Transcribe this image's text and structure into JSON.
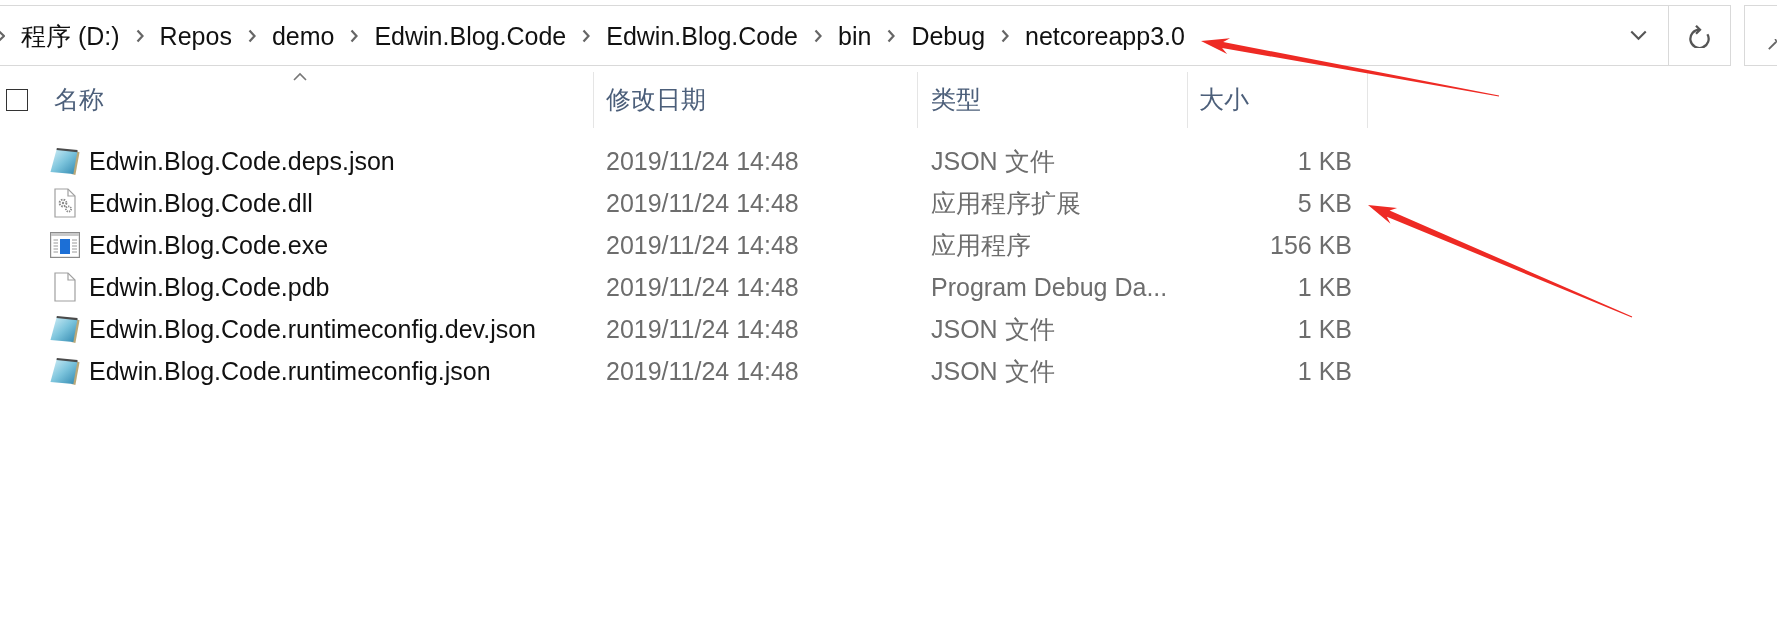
{
  "address_bar": {
    "breadcrumb": [
      "程序 (D:)",
      "Repos",
      "demo",
      "Edwin.Blog.Code",
      "Edwin.Blog.Code",
      "bin",
      "Debug",
      "netcoreapp3.0"
    ]
  },
  "file_list": {
    "select_all": {
      "checked": false
    },
    "columns": [
      {
        "label": "名称",
        "sorted": true
      },
      {
        "label": "修改日期",
        "sorted": false
      },
      {
        "label": "类型",
        "sorted": false
      },
      {
        "label": "大小",
        "sorted": false
      }
    ],
    "files": [
      {
        "kind": "json",
        "name": "Edwin.Blog.Code.deps.json",
        "date_modified": "2019/11/24 14:48",
        "type": "JSON 文件",
        "size": "1 KB"
      },
      {
        "kind": "dll",
        "name": "Edwin.Blog.Code.dll",
        "date_modified": "2019/11/24 14:48",
        "type": "应用程序扩展",
        "size": "5 KB"
      },
      {
        "kind": "exe",
        "name": "Edwin.Blog.Code.exe",
        "date_modified": "2019/11/24 14:48",
        "type": "应用程序",
        "size": "156 KB"
      },
      {
        "kind": "file",
        "name": "Edwin.Blog.Code.pdb",
        "date_modified": "2019/11/24 14:48",
        "type": "Program Debug Da...",
        "size": "1 KB"
      },
      {
        "kind": "json",
        "name": "Edwin.Blog.Code.runtimeconfig.dev.json",
        "date_modified": "2019/11/24 14:48",
        "type": "JSON 文件",
        "size": "1 KB"
      },
      {
        "kind": "json",
        "name": "Edwin.Blog.Code.runtimeconfig.json",
        "date_modified": "2019/11/24 14:48",
        "type": "JSON 文件",
        "size": "1 KB"
      }
    ]
  }
}
